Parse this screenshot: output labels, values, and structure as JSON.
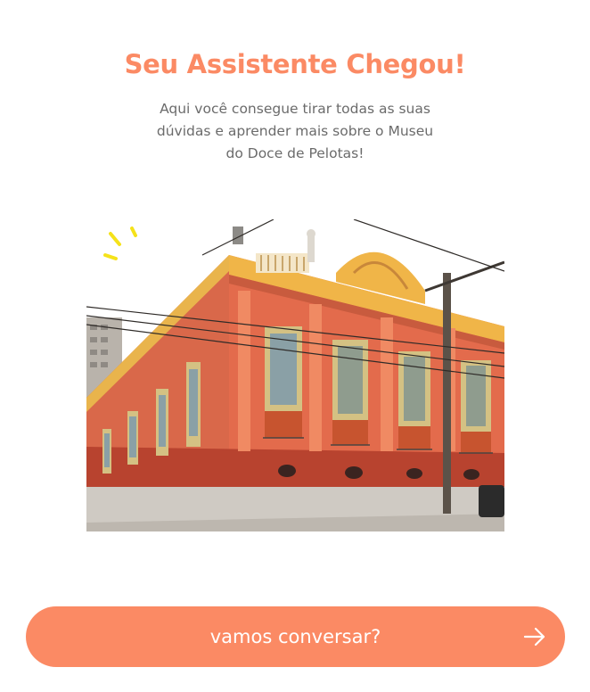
{
  "header": {
    "title": "Seu Assistente Chegou!",
    "subtitle": "Aqui você consegue tirar todas as suas dúvidas e aprender mais sobre o Museu do Doce de Pelotas!"
  },
  "hero": {
    "image_alt": "Fachada do Museu do Doce de Pelotas",
    "decoration_icon": "sparkle-icon"
  },
  "cta": {
    "label": "vamos conversar?",
    "icon": "arrow-right-icon"
  },
  "colors": {
    "accent": "#fb8a64",
    "text_muted": "#6b6b6b",
    "sparkle": "#f5e21a"
  }
}
